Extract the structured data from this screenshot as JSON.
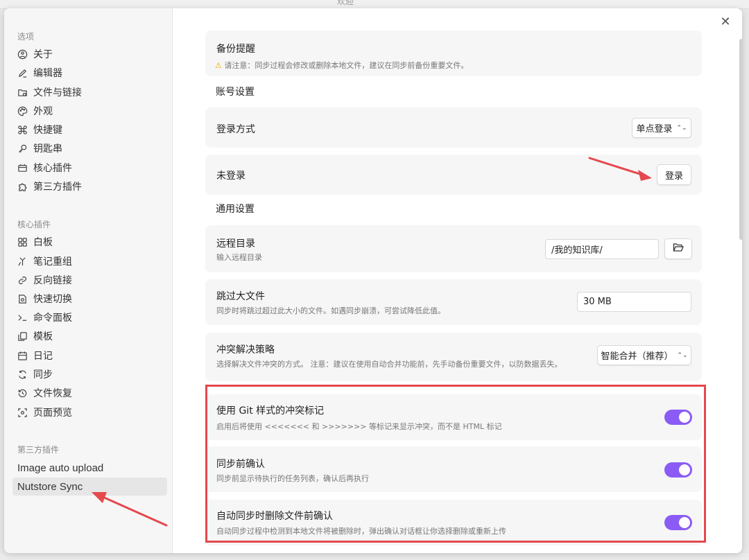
{
  "background": {
    "window_title": "欢迎"
  },
  "sidebar": {
    "options_title": "选项",
    "options": [
      {
        "label": "关于",
        "icon": "info-circle-icon"
      },
      {
        "label": "编辑器",
        "icon": "pencil-icon"
      },
      {
        "label": "文件与链接",
        "icon": "folder-link-icon"
      },
      {
        "label": "外观",
        "icon": "palette-icon"
      },
      {
        "label": "快捷键",
        "icon": "command-icon"
      },
      {
        "label": "钥匙串",
        "icon": "key-icon"
      },
      {
        "label": "核心插件",
        "icon": "plug-icon"
      },
      {
        "label": "第三方插件",
        "icon": "puzzle-icon"
      }
    ],
    "core_title": "核心插件",
    "core": [
      {
        "label": "白板",
        "icon": "grid-icon"
      },
      {
        "label": "笔记重组",
        "icon": "merge-icon"
      },
      {
        "label": "反向链接",
        "icon": "backlink-icon"
      },
      {
        "label": "快速切换",
        "icon": "switch-icon"
      },
      {
        "label": "命令面板",
        "icon": "terminal-icon"
      },
      {
        "label": "模板",
        "icon": "template-icon"
      },
      {
        "label": "日记",
        "icon": "calendar-icon"
      },
      {
        "label": "同步",
        "icon": "sync-icon"
      },
      {
        "label": "文件恢复",
        "icon": "history-icon"
      },
      {
        "label": "页面预览",
        "icon": "preview-icon"
      }
    ],
    "third_title": "第三方插件",
    "third": [
      {
        "label": "Image auto upload"
      },
      {
        "label": "Nutstore Sync"
      }
    ]
  },
  "content": {
    "backup": {
      "title": "备份提醒",
      "warning": "请注意：同步过程会修改或删除本地文件，建议在同步前备份重要文件。"
    },
    "account_heading": "账号设置",
    "login_method": {
      "label": "登录方式",
      "value": "单点登录"
    },
    "login_status": {
      "label": "未登录",
      "button": "登录"
    },
    "general_heading": "通用设置",
    "remote_dir": {
      "label": "远程目录",
      "desc": "输入远程目录",
      "value": "/我的知识库/"
    },
    "skip_large": {
      "label": "跳过大文件",
      "desc": "同步时将跳过超过此大小的文件。如遇同步崩溃，可尝试降低此值。",
      "value": "30 MB"
    },
    "conflict": {
      "label": "冲突解决策略",
      "desc": "选择解决文件冲突的方式。 注意：建议在使用自动合并功能前，先手动备份重要文件，以防数据丢失。",
      "value": "智能合并（推荐）"
    },
    "git_markers": {
      "label": "使用 Git 样式的冲突标记",
      "desc": "启用后将使用 <<<<<<< 和 >>>>>>> 等标记来显示冲突，而不是 HTML 标记",
      "enabled": true
    },
    "confirm_before_sync": {
      "label": "同步前确认",
      "desc": "同步前显示待执行的任务列表，确认后再执行",
      "enabled": true
    },
    "confirm_delete": {
      "label": "自动同步时删除文件前确认",
      "desc": "自动同步过程中检测到本地文件将被删除时，弹出确认对话框让你选择删除或重新上传",
      "enabled": true
    }
  },
  "colors": {
    "accent": "#8a5cf5",
    "highlight": "#e5484d",
    "warning": "#e8a400"
  }
}
